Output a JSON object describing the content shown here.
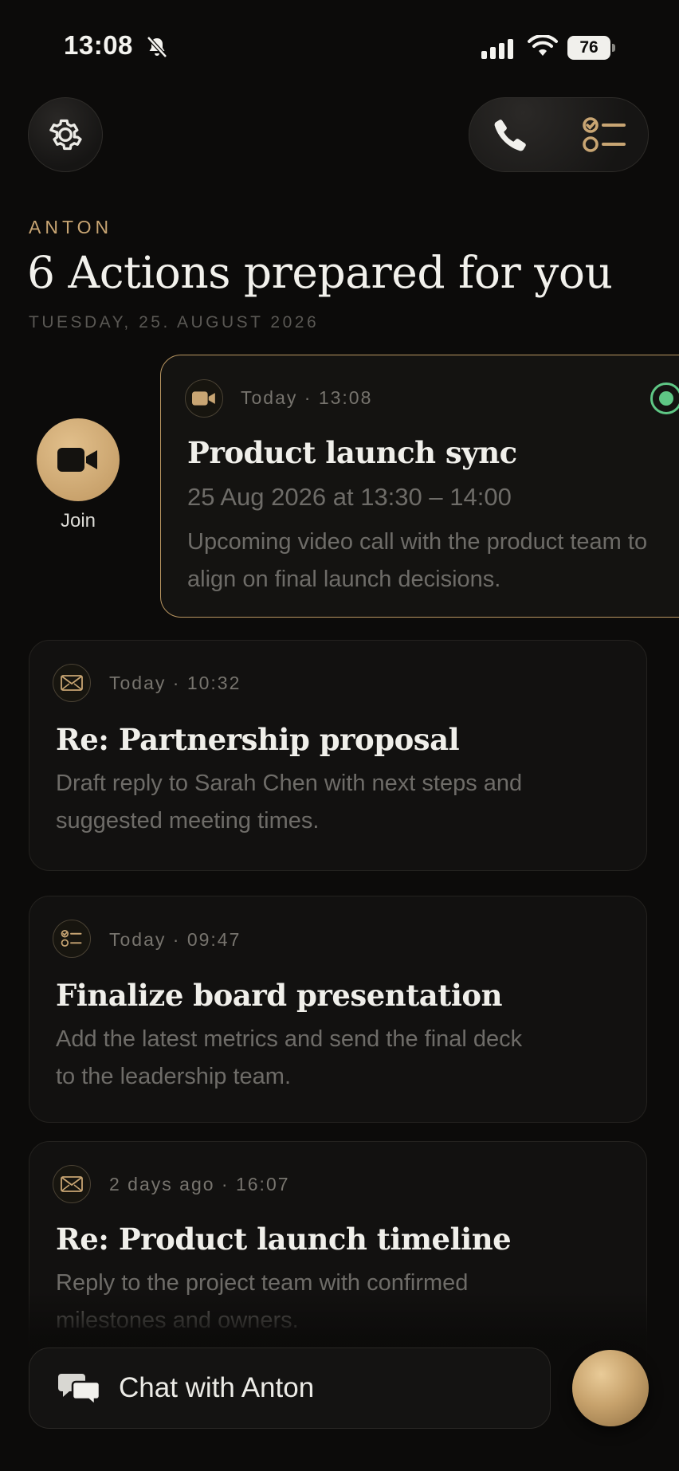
{
  "status_bar": {
    "time": "13:08",
    "battery": "76",
    "icons": [
      "bell-slash-icon",
      "cellular-signal-icon",
      "wifi-icon",
      "battery-icon"
    ]
  },
  "header": {
    "eyebrow": "ANTON",
    "title": "6 Actions prepared for you",
    "date": "TUESDAY, 25. AUGUST 2026"
  },
  "top_buttons": {
    "settings_icon": "gear-icon",
    "call_icon": "phone-icon",
    "tasks_icon": "checklist-icon"
  },
  "join": {
    "label": "Join",
    "icon": "video-camera-icon"
  },
  "cards": [
    {
      "icon": "video-camera-icon",
      "meta": "Today · 13:08",
      "title": "Product launch sync",
      "subtitle": "25 Aug 2026 at 13:30 – 14:00",
      "description": "Upcoming video call with the product team to align on final launch decisions.",
      "status": "live",
      "status_color": "#5fc785"
    },
    {
      "icon": "envelope-icon",
      "meta": "Today · 10:32",
      "title": "Re: Partnership proposal",
      "description": "Draft reply to Sarah Chen with next steps and suggested meeting times."
    },
    {
      "icon": "checklist-icon",
      "meta": "Today · 09:47",
      "title": "Finalize board presentation",
      "description": "Add the latest metrics and send the final deck to the leadership team."
    },
    {
      "icon": "envelope-icon",
      "meta": "2 days ago · 16:07",
      "title": "Re: Product launch timeline",
      "description": "Reply to the project team with confirmed milestones and owners."
    }
  ],
  "chat": {
    "label": "Chat with Anton",
    "icon": "chat-bubbles-icon"
  },
  "colors": {
    "background": "#0c0b0a",
    "accent_gold": "#c8a573",
    "status_green": "#5fc785"
  }
}
